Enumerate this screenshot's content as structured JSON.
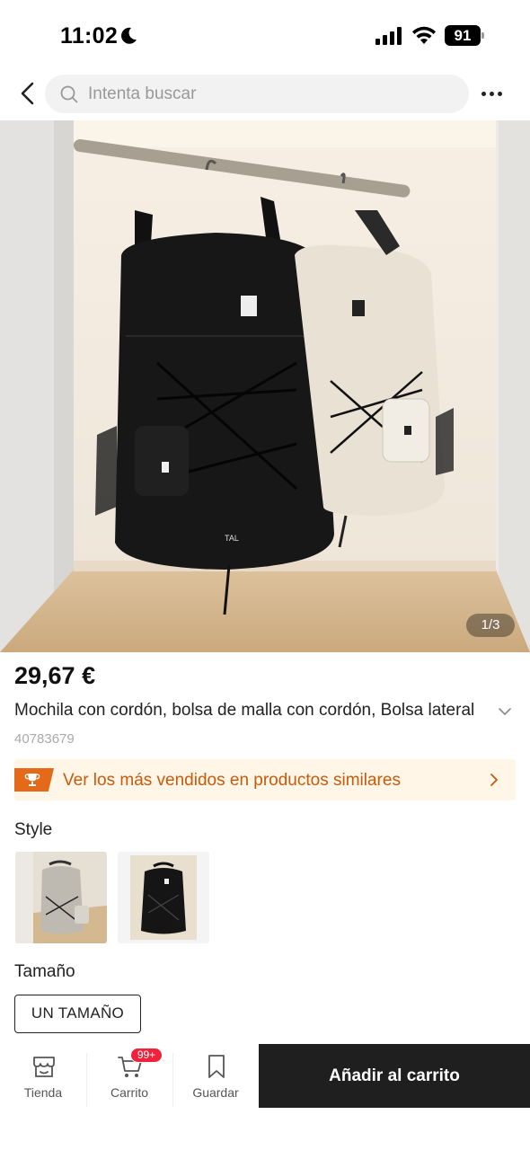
{
  "status_bar": {
    "time": "11:02",
    "battery": "91"
  },
  "search": {
    "placeholder": "Intenta buscar"
  },
  "gallery": {
    "counter": "1/3",
    "brand_mark": "TAL"
  },
  "product": {
    "price": "29,67 €",
    "title": "Mochila con cordón, bolsa de malla con cordón, Bolsa lateral",
    "sku": "40783679"
  },
  "bestseller_banner": {
    "label": "Ver los más vendidos en productos similares"
  },
  "style": {
    "label": "Style",
    "options": [
      "beige-backpack",
      "black-backpack"
    ]
  },
  "size": {
    "label": "Tamaño",
    "selected": "UN TAMAÑO"
  },
  "bottom_bar": {
    "store_label": "Tienda",
    "cart_label": "Carrito",
    "cart_badge": "99+",
    "save_label": "Guardar",
    "add_to_cart_label": "Añadir al carrito"
  },
  "colors": {
    "accent": "#e46a1a",
    "banner_bg": "#fff6e8",
    "badge": "#f0213b",
    "cta": "#1f1f1f"
  }
}
